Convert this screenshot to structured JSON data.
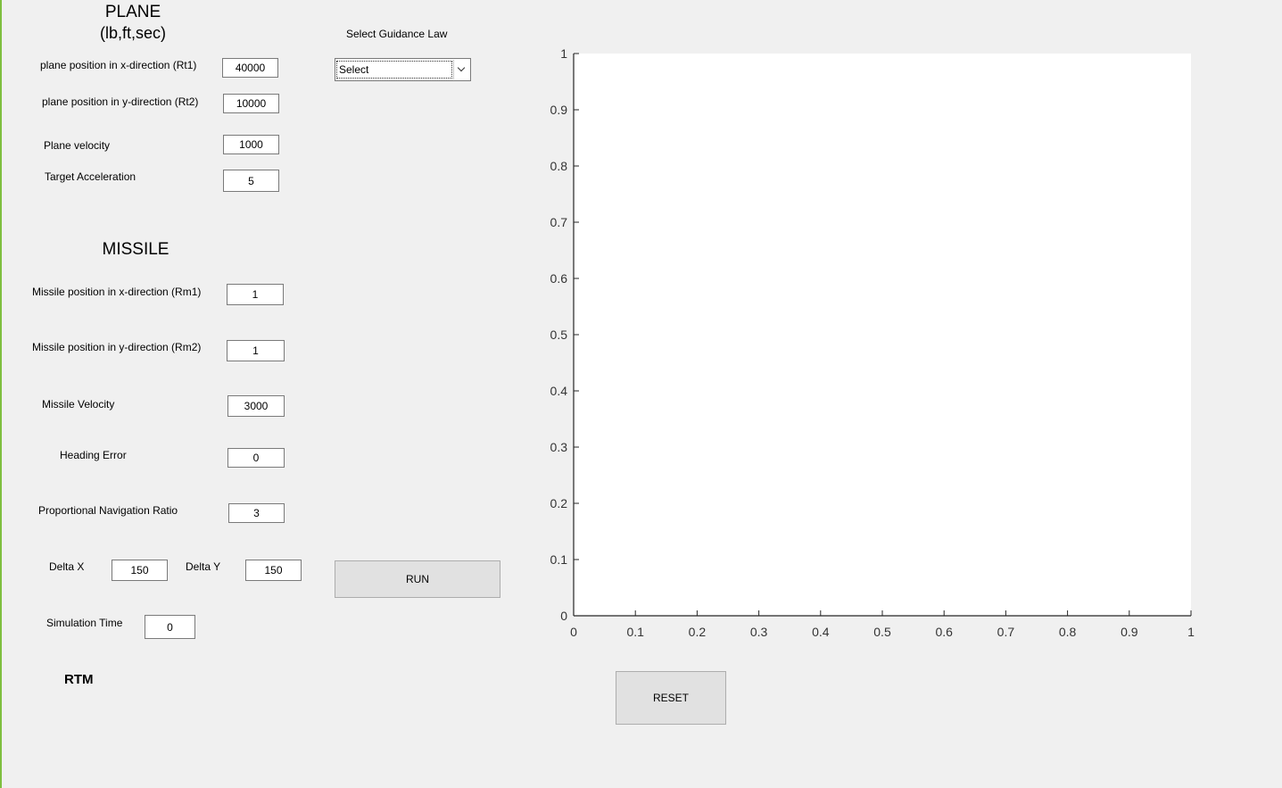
{
  "plane": {
    "title": "PLANE",
    "units": "(lb,ft,sec)",
    "rt1_label": "plane position in x-direction (Rt1)",
    "rt1_value": "40000",
    "rt2_label": "plane position in y-direction (Rt2)",
    "rt2_value": "10000",
    "velocity_label": "Plane velocity",
    "velocity_value": "1000",
    "accel_label": "Target Acceleration",
    "accel_value": "5"
  },
  "guidance": {
    "label": "Select Guidance Law",
    "selected": "Select"
  },
  "missile": {
    "title": "MISSILE",
    "rm1_label": "Missile position in x-direction (Rm1)",
    "rm1_value": "1",
    "rm2_label": "Missile position in y-direction (Rm2)",
    "rm2_value": "1",
    "velocity_label": "Missile Velocity",
    "velocity_value": "3000",
    "heading_label": "Heading Error",
    "heading_value": "0",
    "pnr_label": "Proportional Navigation Ratio",
    "pnr_value": "3",
    "deltax_label": "Delta X",
    "deltax_value": "150",
    "deltay_label": "Delta Y",
    "deltay_value": "150",
    "simtime_label": "Simulation Time",
    "simtime_value": "0",
    "rtm_label": "RTM"
  },
  "buttons": {
    "run": "RUN",
    "reset": "RESET"
  },
  "chart_data": {
    "type": "line",
    "series": [],
    "title": "",
    "xlabel": "",
    "ylabel": "",
    "xlim": [
      0,
      1
    ],
    "ylim": [
      0,
      1
    ],
    "xticks": [
      "0",
      "0.1",
      "0.2",
      "0.3",
      "0.4",
      "0.5",
      "0.6",
      "0.7",
      "0.8",
      "0.9",
      "1"
    ],
    "yticks": [
      "0",
      "0.1",
      "0.2",
      "0.3",
      "0.4",
      "0.5",
      "0.6",
      "0.7",
      "0.8",
      "0.9",
      "1"
    ],
    "grid": false
  }
}
